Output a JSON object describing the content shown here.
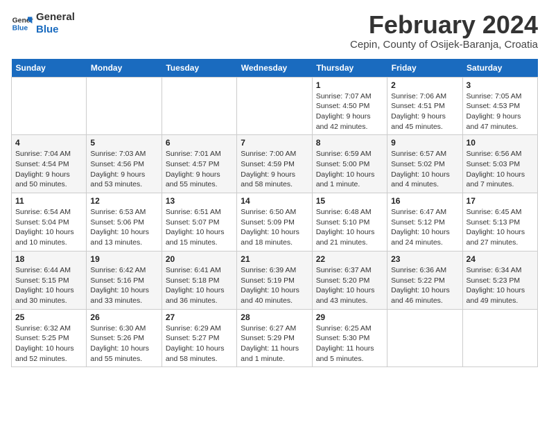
{
  "logo": {
    "line1": "General",
    "line2": "Blue"
  },
  "title": "February 2024",
  "subtitle": "Cepin, County of Osijek-Baranja, Croatia",
  "days_of_week": [
    "Sunday",
    "Monday",
    "Tuesday",
    "Wednesday",
    "Thursday",
    "Friday",
    "Saturday"
  ],
  "weeks": [
    [
      {
        "day": "",
        "info": ""
      },
      {
        "day": "",
        "info": ""
      },
      {
        "day": "",
        "info": ""
      },
      {
        "day": "",
        "info": ""
      },
      {
        "day": "1",
        "info": "Sunrise: 7:07 AM\nSunset: 4:50 PM\nDaylight: 9 hours\nand 42 minutes."
      },
      {
        "day": "2",
        "info": "Sunrise: 7:06 AM\nSunset: 4:51 PM\nDaylight: 9 hours\nand 45 minutes."
      },
      {
        "day": "3",
        "info": "Sunrise: 7:05 AM\nSunset: 4:53 PM\nDaylight: 9 hours\nand 47 minutes."
      }
    ],
    [
      {
        "day": "4",
        "info": "Sunrise: 7:04 AM\nSunset: 4:54 PM\nDaylight: 9 hours\nand 50 minutes."
      },
      {
        "day": "5",
        "info": "Sunrise: 7:03 AM\nSunset: 4:56 PM\nDaylight: 9 hours\nand 53 minutes."
      },
      {
        "day": "6",
        "info": "Sunrise: 7:01 AM\nSunset: 4:57 PM\nDaylight: 9 hours\nand 55 minutes."
      },
      {
        "day": "7",
        "info": "Sunrise: 7:00 AM\nSunset: 4:59 PM\nDaylight: 9 hours\nand 58 minutes."
      },
      {
        "day": "8",
        "info": "Sunrise: 6:59 AM\nSunset: 5:00 PM\nDaylight: 10 hours\nand 1 minute."
      },
      {
        "day": "9",
        "info": "Sunrise: 6:57 AM\nSunset: 5:02 PM\nDaylight: 10 hours\nand 4 minutes."
      },
      {
        "day": "10",
        "info": "Sunrise: 6:56 AM\nSunset: 5:03 PM\nDaylight: 10 hours\nand 7 minutes."
      }
    ],
    [
      {
        "day": "11",
        "info": "Sunrise: 6:54 AM\nSunset: 5:04 PM\nDaylight: 10 hours\nand 10 minutes."
      },
      {
        "day": "12",
        "info": "Sunrise: 6:53 AM\nSunset: 5:06 PM\nDaylight: 10 hours\nand 13 minutes."
      },
      {
        "day": "13",
        "info": "Sunrise: 6:51 AM\nSunset: 5:07 PM\nDaylight: 10 hours\nand 15 minutes."
      },
      {
        "day": "14",
        "info": "Sunrise: 6:50 AM\nSunset: 5:09 PM\nDaylight: 10 hours\nand 18 minutes."
      },
      {
        "day": "15",
        "info": "Sunrise: 6:48 AM\nSunset: 5:10 PM\nDaylight: 10 hours\nand 21 minutes."
      },
      {
        "day": "16",
        "info": "Sunrise: 6:47 AM\nSunset: 5:12 PM\nDaylight: 10 hours\nand 24 minutes."
      },
      {
        "day": "17",
        "info": "Sunrise: 6:45 AM\nSunset: 5:13 PM\nDaylight: 10 hours\nand 27 minutes."
      }
    ],
    [
      {
        "day": "18",
        "info": "Sunrise: 6:44 AM\nSunset: 5:15 PM\nDaylight: 10 hours\nand 30 minutes."
      },
      {
        "day": "19",
        "info": "Sunrise: 6:42 AM\nSunset: 5:16 PM\nDaylight: 10 hours\nand 33 minutes."
      },
      {
        "day": "20",
        "info": "Sunrise: 6:41 AM\nSunset: 5:18 PM\nDaylight: 10 hours\nand 36 minutes."
      },
      {
        "day": "21",
        "info": "Sunrise: 6:39 AM\nSunset: 5:19 PM\nDaylight: 10 hours\nand 40 minutes."
      },
      {
        "day": "22",
        "info": "Sunrise: 6:37 AM\nSunset: 5:20 PM\nDaylight: 10 hours\nand 43 minutes."
      },
      {
        "day": "23",
        "info": "Sunrise: 6:36 AM\nSunset: 5:22 PM\nDaylight: 10 hours\nand 46 minutes."
      },
      {
        "day": "24",
        "info": "Sunrise: 6:34 AM\nSunset: 5:23 PM\nDaylight: 10 hours\nand 49 minutes."
      }
    ],
    [
      {
        "day": "25",
        "info": "Sunrise: 6:32 AM\nSunset: 5:25 PM\nDaylight: 10 hours\nand 52 minutes."
      },
      {
        "day": "26",
        "info": "Sunrise: 6:30 AM\nSunset: 5:26 PM\nDaylight: 10 hours\nand 55 minutes."
      },
      {
        "day": "27",
        "info": "Sunrise: 6:29 AM\nSunset: 5:27 PM\nDaylight: 10 hours\nand 58 minutes."
      },
      {
        "day": "28",
        "info": "Sunrise: 6:27 AM\nSunset: 5:29 PM\nDaylight: 11 hours\nand 1 minute."
      },
      {
        "day": "29",
        "info": "Sunrise: 6:25 AM\nSunset: 5:30 PM\nDaylight: 11 hours\nand 5 minutes."
      },
      {
        "day": "",
        "info": ""
      },
      {
        "day": "",
        "info": ""
      }
    ]
  ]
}
